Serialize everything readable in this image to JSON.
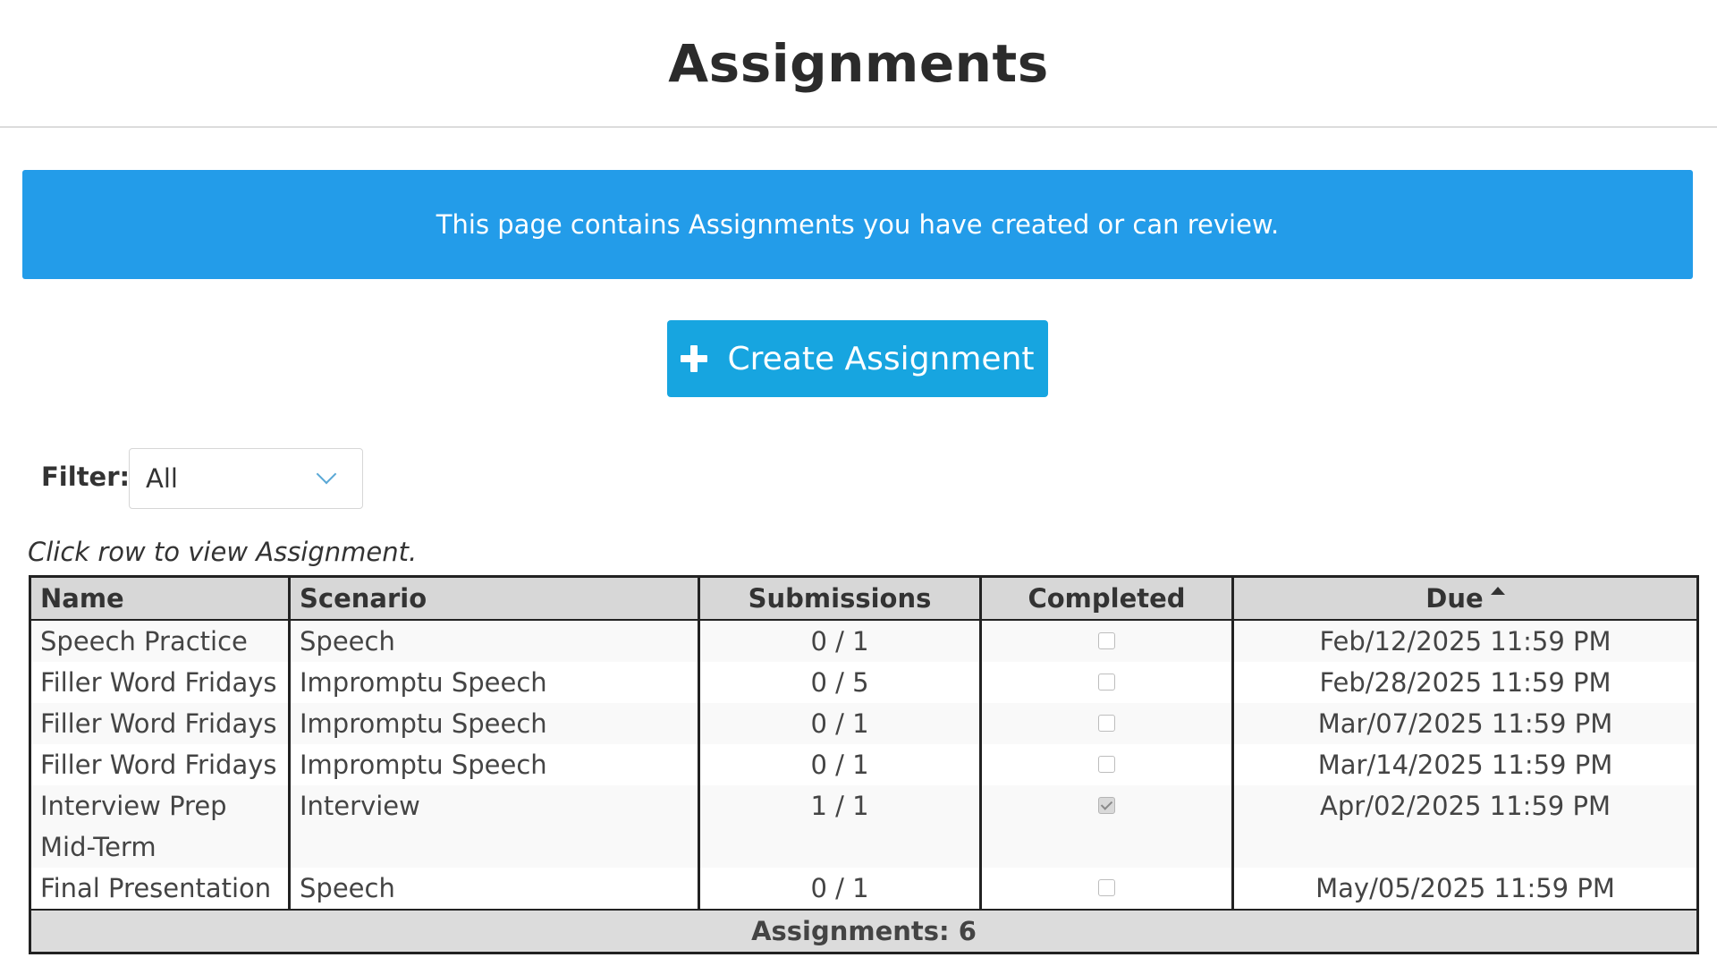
{
  "page": {
    "title": "Assignments"
  },
  "banner": {
    "text": "This page contains Assignments you have created or can review."
  },
  "create_button": {
    "label": "Create Assignment",
    "icon": "plus-icon"
  },
  "filter": {
    "label": "Filter:",
    "selected": "All",
    "icon": "chevron-down-icon"
  },
  "hint": "Click row to view Assignment.",
  "table": {
    "columns": [
      "Name",
      "Scenario",
      "Submissions",
      "Completed",
      "Due"
    ],
    "sort": {
      "column": "Due",
      "direction": "ascending"
    },
    "rows": [
      {
        "name": "Speech Practice",
        "scenario": "Speech",
        "submissions": "0 / 1",
        "completed": false,
        "due": "Feb/12/2025 11:59 PM"
      },
      {
        "name": "Filler Word Fridays",
        "scenario": "Impromptu Speech",
        "submissions": "0 / 5",
        "completed": false,
        "due": "Feb/28/2025 11:59 PM"
      },
      {
        "name": "Filler Word Fridays",
        "scenario": "Impromptu Speech",
        "submissions": "0 / 1",
        "completed": false,
        "due": "Mar/07/2025 11:59 PM"
      },
      {
        "name": "Filler Word Fridays",
        "scenario": "Impromptu Speech",
        "submissions": "0 / 1",
        "completed": false,
        "due": "Mar/14/2025 11:59 PM"
      },
      {
        "name": "Interview Prep Mid-Term",
        "scenario": "Interview",
        "submissions": "1 / 1",
        "completed": true,
        "due": "Apr/02/2025 11:59 PM"
      },
      {
        "name": "Final Presentation",
        "scenario": "Speech",
        "submissions": "0 / 1",
        "completed": false,
        "due": "May/05/2025 11:59 PM"
      }
    ],
    "footer": "Assignments: 6"
  }
}
